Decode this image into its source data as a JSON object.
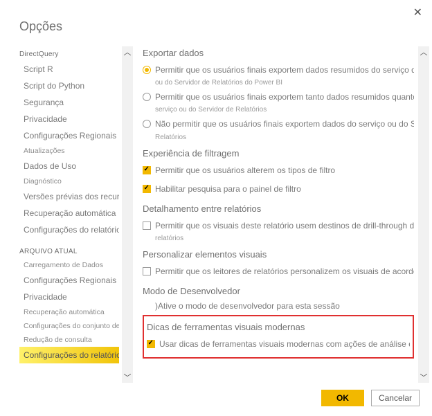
{
  "title": "Opções",
  "close_glyph": "✕",
  "sidebar": {
    "arrow_up": "︿",
    "arrow_down": "﹀",
    "section1_label": "DirectQuery",
    "items1": [
      "Script R",
      "Script do Python",
      "Segurança",
      "Privacidade",
      "Configurações Regionais",
      "Atualizações",
      "Dados de Uso",
      "Diagnóstico",
      "Versões prévias dos recursos",
      "Recuperação automática",
      "Configurações do relatório"
    ],
    "section2_label": "ARQUIVO ATUAL",
    "items2": [
      "Carregamento de Dados",
      "Configurações Regionais",
      "Privacidade",
      "Recuperação automática",
      "Configurações do conjunto de dados publicado",
      "Redução de consulta",
      "Configurações do relatório"
    ]
  },
  "main": {
    "arrow_up": "︿",
    "arrow_down": "﹀",
    "export": {
      "title": "Exportar dados",
      "opt1": "Permitir que os usuários finais exportem dados resumidos do serviço do Power BI",
      "opt1_sub": "ou do Servidor de Relatórios do Power BI",
      "opt2": "Permitir que os usuários finais exportem tanto dados resumidos quanto subjacentes",
      "opt2_sub": "serviço ou do Servidor de Relatórios",
      "opt3": "Não permitir que os usuários finais exportem dados do serviço ou do Servidor de",
      "opt3_sub": "Relatórios"
    },
    "filter": {
      "title": "Experiência de filtragem",
      "opt1": "Permitir que os usuários alterem os tipos de filtro",
      "opt2": "Habilitar pesquisa para o painel de filtro"
    },
    "drill": {
      "title": "Detalhamento entre relatórios",
      "opt1": "Permitir que os visuais deste relatório usem destinos de drill-through de outros",
      "opt1_sub": "relatórios"
    },
    "pers": {
      "title": "Personalizar elementos visuais",
      "opt1": "Permitir que os leitores de relatórios personalizem os visuais de acordo com"
    },
    "dev": {
      "title": "Modo de Desenvolvedor",
      "text": ")Ative o modo de desenvolvedor para esta sessão"
    },
    "tooltip": {
      "title": "Dicas de ferramentas visuais modernas",
      "opt1": "Usar dicas de ferramentas visuais modernas com ações de análise e estilo"
    }
  },
  "footer": {
    "ok": "OK",
    "cancel": "Cancelar"
  }
}
